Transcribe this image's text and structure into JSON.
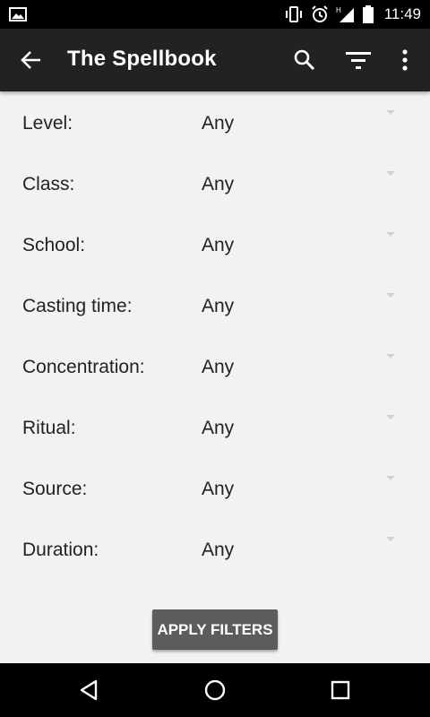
{
  "status_bar": {
    "time": "11:49",
    "icons": [
      "gallery-icon",
      "vibrate-icon",
      "alarm-icon",
      "signal-h-icon",
      "battery-icon"
    ]
  },
  "app_bar": {
    "title": "The Spellbook",
    "icons": [
      "back-arrow-icon",
      "search-icon",
      "filter-icon",
      "more-vert-icon"
    ]
  },
  "filters": [
    {
      "label": "Level:",
      "value": "Any"
    },
    {
      "label": "Class:",
      "value": "Any"
    },
    {
      "label": "School:",
      "value": "Any"
    },
    {
      "label": "Casting time:",
      "value": "Any"
    },
    {
      "label": "Concentration:",
      "value": "Any"
    },
    {
      "label": "Ritual:",
      "value": "Any"
    },
    {
      "label": "Source:",
      "value": "Any"
    },
    {
      "label": "Duration:",
      "value": "Any"
    }
  ],
  "apply_button": {
    "label": "APPLY FILTERS"
  },
  "nav_bar": {
    "icons": [
      "back-icon",
      "home-icon",
      "recents-icon"
    ]
  },
  "colors": {
    "app_bar": "#222222",
    "background": "#f2f2f2",
    "button": "#5c5c5c"
  }
}
